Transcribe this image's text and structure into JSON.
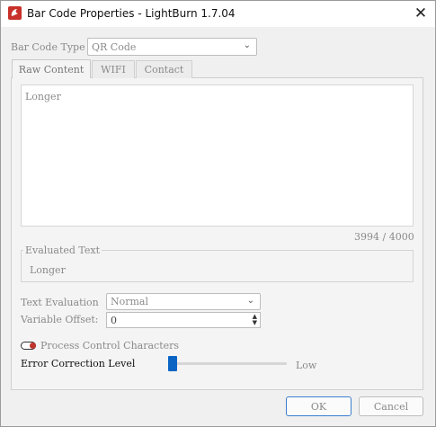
{
  "window": {
    "title": "Bar Code Properties - LightBurn 1.7.04",
    "close_glyph": "✕"
  },
  "form": {
    "barcode_type_label": "Bar Code Type",
    "barcode_type_value": "QR Code",
    "tabs": [
      {
        "label": "Raw Content",
        "active": true
      },
      {
        "label": "WIFI",
        "active": false
      },
      {
        "label": "Contact",
        "active": false
      }
    ],
    "raw_content_text": "Longer",
    "char_counter": "3994 / 4000",
    "evaluated_text_label": "Evaluated Text",
    "evaluated_text_value": "Longer",
    "text_evaluation_label": "Text Evaluation",
    "text_evaluation_value": "Normal",
    "variable_offset_label": "Variable Offset:",
    "variable_offset_value": "0",
    "process_control_label": "Process Control Characters",
    "process_control_on": false,
    "error_correction_label": "Error Correction Level",
    "error_correction_value": "Low",
    "error_correction_level": 0
  },
  "buttons": {
    "ok": "OK",
    "cancel": "Cancel"
  },
  "icons": {
    "app": "lightburn-logo-icon",
    "dropdown": "chevron-down-icon",
    "spin_up": "spin-up-icon",
    "spin_down": "spin-down-icon"
  },
  "colors": {
    "accent": "#0a64c4",
    "toggle_off": "#c0342b"
  }
}
